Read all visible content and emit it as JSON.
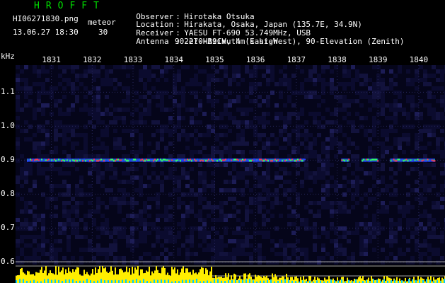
{
  "app": {
    "title": "HROFFT"
  },
  "file": {
    "name": "HI06271830.png",
    "datetime": "13.06.27 18:30",
    "count_label": "meteor",
    "count_value": "30"
  },
  "station": {
    "observer_label": "Observer",
    "observer": "Hirotaka Otsuka",
    "location_label": "Location",
    "location": "Hirakata, Osaka, Japan (135.7E, 34.9N)",
    "receiver_label": "Receiver",
    "receiver": "YAESU FT-690 53.749MHz, USB",
    "antenna_label": "Antenna",
    "antenna": "2el-HB9CV, 4m's high",
    "antenna_detail": "90-270-Azimuth (East-West), 90-Elevation (Zenith)",
    "separator": ":"
  },
  "chart_data": {
    "type": "heatmap",
    "ylabel": "kHz",
    "x_ticks": [
      "1831",
      "1832",
      "1833",
      "1834",
      "1835",
      "1836",
      "1837",
      "1838",
      "1839",
      "1840"
    ],
    "y_ticks": [
      "1.1",
      "1.0",
      "0.9",
      "0.8",
      "0.7",
      "0.6"
    ],
    "x_range": [
      1830.4,
      1840.4
    ],
    "y_range": [
      0.58,
      1.18
    ],
    "grid": true,
    "carrier_trace": {
      "frequency_khz": 0.9,
      "segments": [
        {
          "start": 1830.4,
          "end": 1837.2
        },
        {
          "start": 1838.1,
          "end": 1838.3
        },
        {
          "start": 1838.6,
          "end": 1839.0
        },
        {
          "start": 1839.3,
          "end": 1840.4
        }
      ]
    },
    "colors": {
      "background": "#0a0a2a",
      "grid": "#2a2a60",
      "trace_core": "#ff3355",
      "trace_mid": "#33ff66",
      "trace_edge": "#2244ff",
      "baseline_bars": "#ffee00",
      "baseline_cyan": "#00ccff",
      "ref_line": "#c0c0c0"
    }
  }
}
